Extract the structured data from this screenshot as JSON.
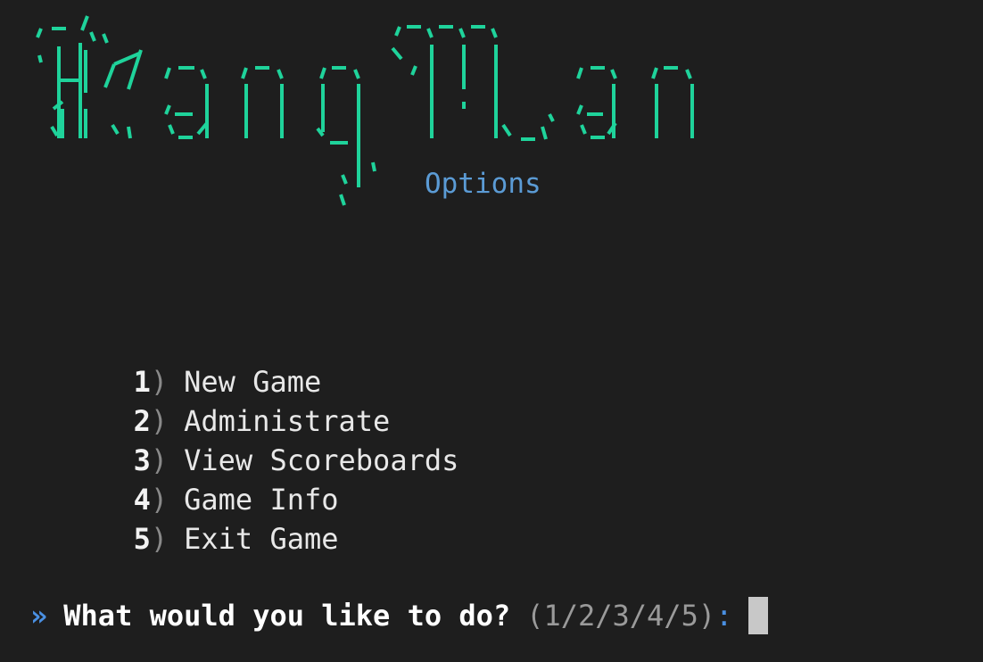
{
  "terminal": {
    "banner": {
      "logo_text": "HangMan",
      "subtitle": "Options"
    },
    "menu": {
      "items": [
        {
          "number": "1",
          "paren": ")",
          "label": "New Game"
        },
        {
          "number": "2",
          "paren": ")",
          "label": "Administrate"
        },
        {
          "number": "3",
          "paren": ")",
          "label": "View Scoreboards"
        },
        {
          "number": "4",
          "paren": ")",
          "label": "Game Info"
        },
        {
          "number": "5",
          "paren": ")",
          "label": "Exit Game"
        }
      ]
    },
    "prompt": {
      "arrow": "»",
      "question": "What would you like to do?",
      "choices": "(1/2/3/4/5)",
      "colon": ":"
    },
    "colors": {
      "background": "#1e1e1e",
      "banner": "#1fd39b",
      "subtitle": "#5b9bd5",
      "prompt_accent": "#4a90e2",
      "cursor": "#c8c8c8"
    }
  }
}
